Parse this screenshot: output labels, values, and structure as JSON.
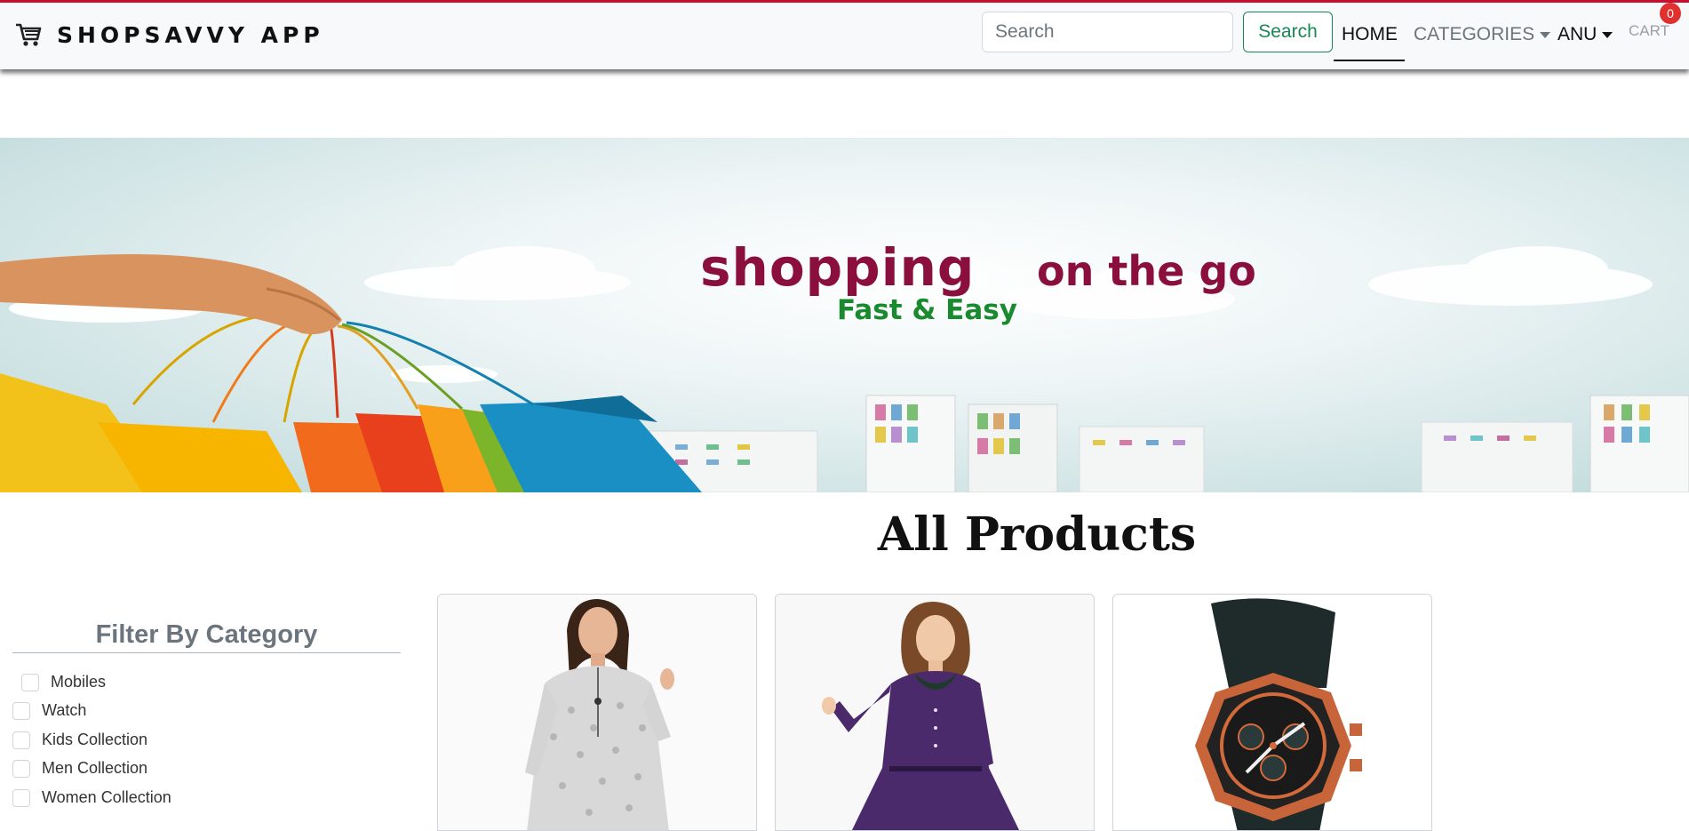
{
  "navbar": {
    "brand": "SHOPSAVVY APP",
    "search_placeholder": "Search",
    "search_button": "Search",
    "links": {
      "home": "HOME",
      "categories": "CATEGORIES",
      "user": "ANU",
      "cart": "CART"
    },
    "cart_count": "0",
    "accent_color": "#198754",
    "top_border_color": "#c8102e"
  },
  "banner": {
    "headline_1": "shopping",
    "headline_2": "on the go",
    "subline": "Fast & Easy",
    "headline_color": "#8a0f3c",
    "subline_color": "#1a8a2e"
  },
  "filter": {
    "title": "Filter By Category",
    "items": [
      {
        "label": "Mobiles",
        "checked": false
      },
      {
        "label": "Watch",
        "checked": false
      },
      {
        "label": "Kids Collection",
        "checked": false
      },
      {
        "label": "Men Collection",
        "checked": false
      },
      {
        "label": "Women Collection",
        "checked": false
      }
    ]
  },
  "products": {
    "title": "All Products",
    "cards": [
      {
        "image": "grey-printed-kurti-photo"
      },
      {
        "image": "purple-dress-photo"
      },
      {
        "image": "orange-sport-watch-photo"
      }
    ]
  },
  "icons": {
    "brand": "shopping-cart-icon",
    "caret": "caret-down-icon"
  }
}
